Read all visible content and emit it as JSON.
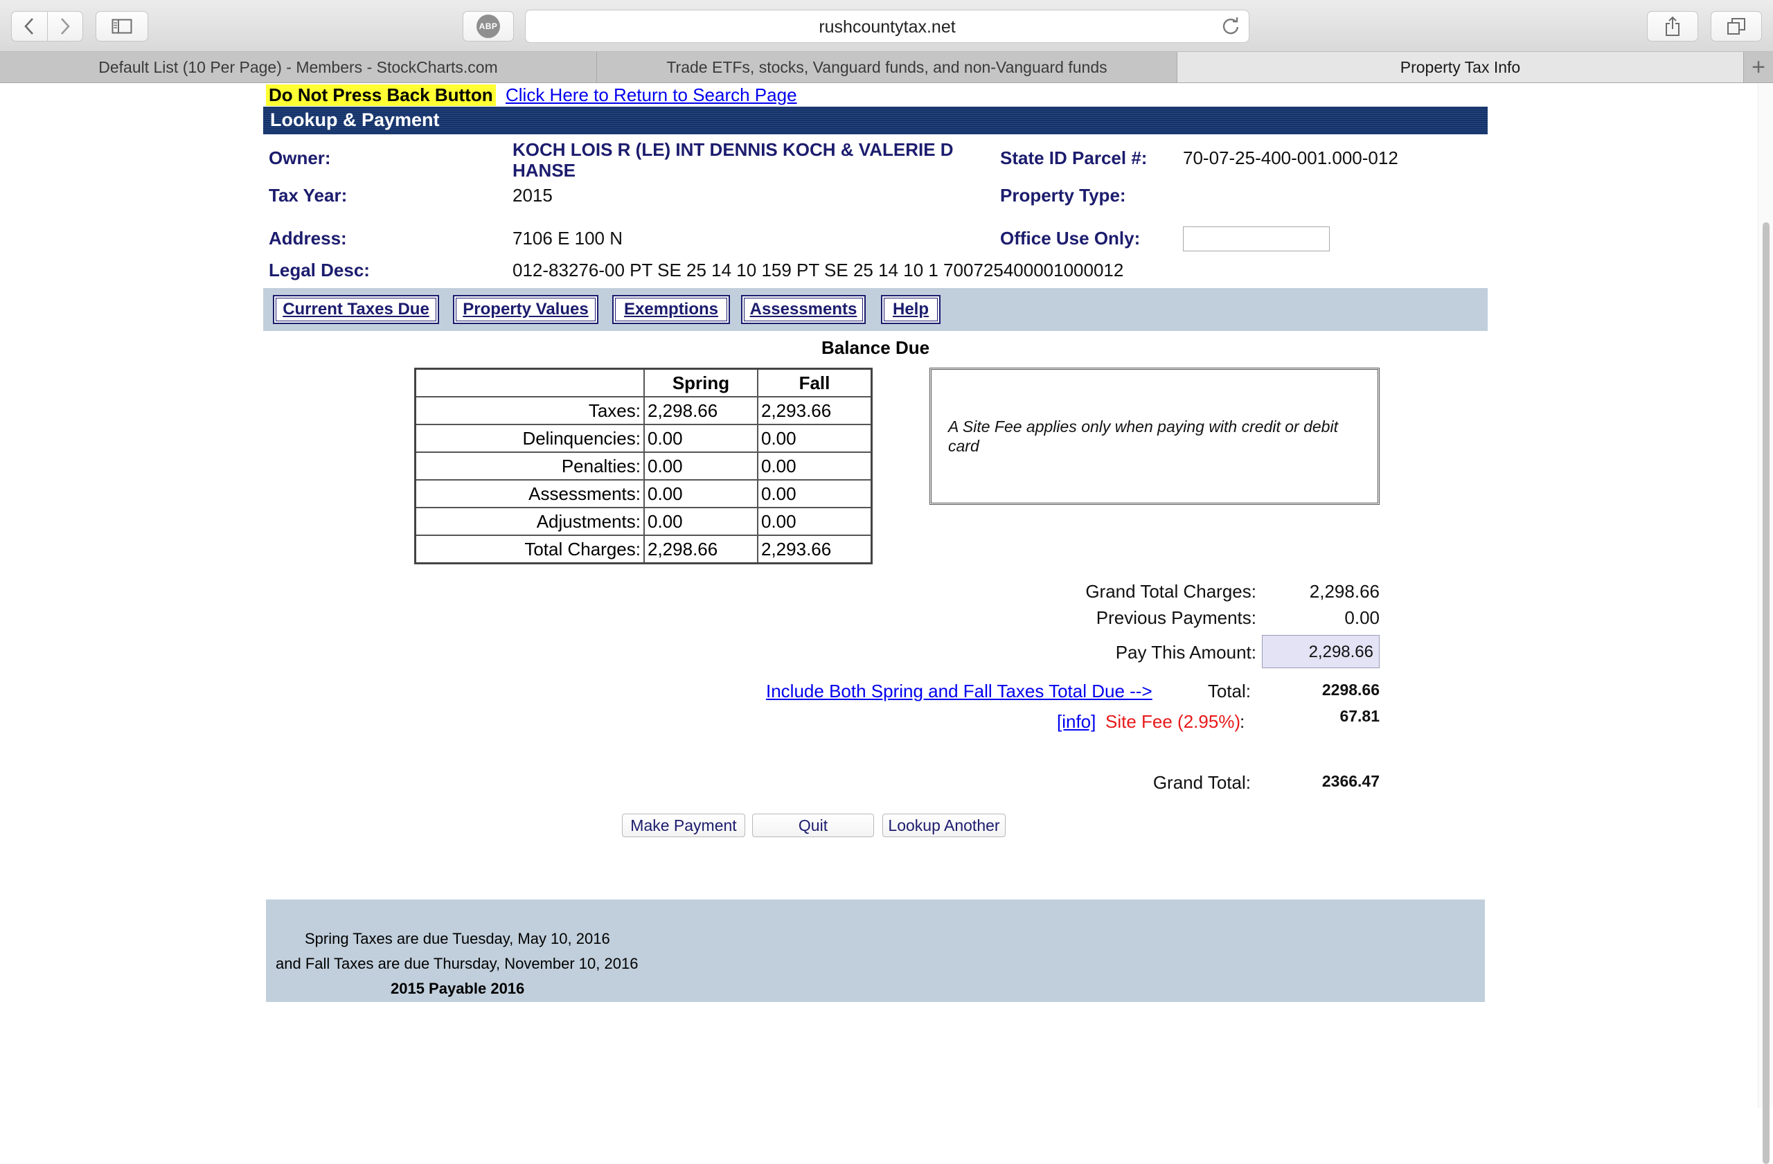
{
  "browser": {
    "url": "rushcountytax.net",
    "abp_label": "ABP",
    "tabs": [
      {
        "label": "Default List (10 Per Page) - Members - StockCharts.com",
        "active": false
      },
      {
        "label": "Trade ETFs, stocks, Vanguard funds, and non-Vanguard funds",
        "active": false
      },
      {
        "label": "Property Tax Info",
        "active": true
      }
    ],
    "new_tab_symbol": "+"
  },
  "page": {
    "warning": "Do Not Press Back Button",
    "return_link": "Click Here to Return to Search Page",
    "title": "Lookup & Payment",
    "fields": {
      "owner_label": "Owner:",
      "owner_value": "KOCH LOIS R (LE) INT DENNIS KOCH & VALERIE D HANSE",
      "state_id_label": "State ID Parcel #:",
      "state_id_value": "70-07-25-400-001.000-012",
      "tax_year_label": "Tax Year:",
      "tax_year_value": "2015",
      "property_type_label": "Property Type:",
      "address_label": "Address:",
      "address_value": "7106 E 100 N",
      "office_use_label": "Office Use Only:",
      "legal_desc_label": "Legal Desc:",
      "legal_desc_value": "012-83276-00 PT SE 25 14 10 159 PT SE 25 14 10 1 700725400001000012"
    },
    "nav_buttons": [
      "Current Taxes Due",
      "Property Values",
      "Exemptions",
      "Assessments",
      "Help"
    ],
    "balance_heading": "Balance Due",
    "charges": {
      "headers": [
        "",
        "Spring",
        "Fall"
      ],
      "rows": [
        {
          "label": "Taxes:",
          "spring": "2,298.66",
          "fall": "2,293.66"
        },
        {
          "label": "Delinquencies:",
          "spring": "0.00",
          "fall": "0.00"
        },
        {
          "label": "Penalties:",
          "spring": "0.00",
          "fall": "0.00"
        },
        {
          "label": "Assessments:",
          "spring": "0.00",
          "fall": "0.00"
        },
        {
          "label": "Adjustments:",
          "spring": "0.00",
          "fall": "0.00"
        },
        {
          "label": "Total Charges:",
          "spring": "2,298.66",
          "fall": "2,293.66"
        }
      ]
    },
    "site_fee_note": "A Site Fee applies only when paying with credit or debit card",
    "summary": {
      "grand_total_charges_label": "Grand Total Charges:",
      "grand_total_charges_value": "2,298.66",
      "previous_payments_label": "Previous Payments:",
      "previous_payments_value": "0.00",
      "pay_amount_label": "Pay This Amount:",
      "pay_amount_value": "2,298.66",
      "include_both_link": "Include Both Spring and Fall Taxes Total Due -->",
      "total_label": "Total:",
      "total_value": "2298.66",
      "info_link": "[info]",
      "site_fee_label": "Site Fee (2.95%)",
      "site_fee_colon": ":",
      "site_fee_value": "67.81",
      "grand_total_label": "Grand Total:",
      "grand_total_value": "2366.47"
    },
    "actions": [
      "Make Payment",
      "Quit",
      "Lookup Another"
    ],
    "footer": {
      "spring_due": "Spring Taxes are due Tuesday, May 10, 2016",
      "fall_due": "and Fall Taxes are due Thursday, November 10, 2016",
      "payable": "2015 Payable 2016"
    },
    "colors": {
      "navy_text": "#1c1c6e",
      "title_bar": "#13326b",
      "band": "#c1cfdc",
      "warning_bg": "#ffff33",
      "site_fee_red": "#e8191b"
    }
  }
}
